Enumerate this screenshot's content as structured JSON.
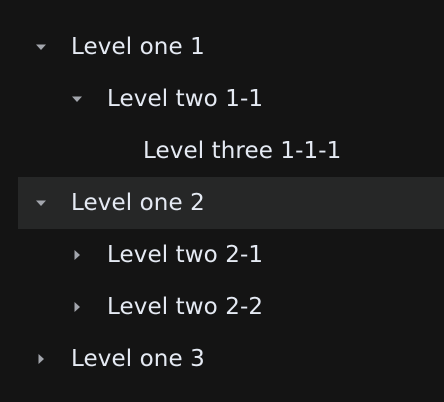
{
  "tree": {
    "nodes": [
      {
        "label": "Level one 1",
        "level": 1,
        "state": "expanded",
        "selected": false
      },
      {
        "label": "Level two 1-1",
        "level": 2,
        "state": "expanded",
        "selected": false
      },
      {
        "label": "Level three 1-1-1",
        "level": 3,
        "state": "leaf",
        "selected": false
      },
      {
        "label": "Level one 2",
        "level": 1,
        "state": "expanded",
        "selected": true
      },
      {
        "label": "Level two 2-1",
        "level": 2,
        "state": "collapsed",
        "selected": false
      },
      {
        "label": "Level two 2-2",
        "level": 2,
        "state": "collapsed",
        "selected": false
      },
      {
        "label": "Level one 3",
        "level": 1,
        "state": "collapsed",
        "selected": false
      }
    ]
  },
  "colors": {
    "background": "#141414",
    "text": "#e5eaf3",
    "caret": "#a3a6ad",
    "selected_row": "#262727"
  },
  "icons": {
    "expanded": "caret-down-icon",
    "collapsed": "caret-right-icon"
  }
}
